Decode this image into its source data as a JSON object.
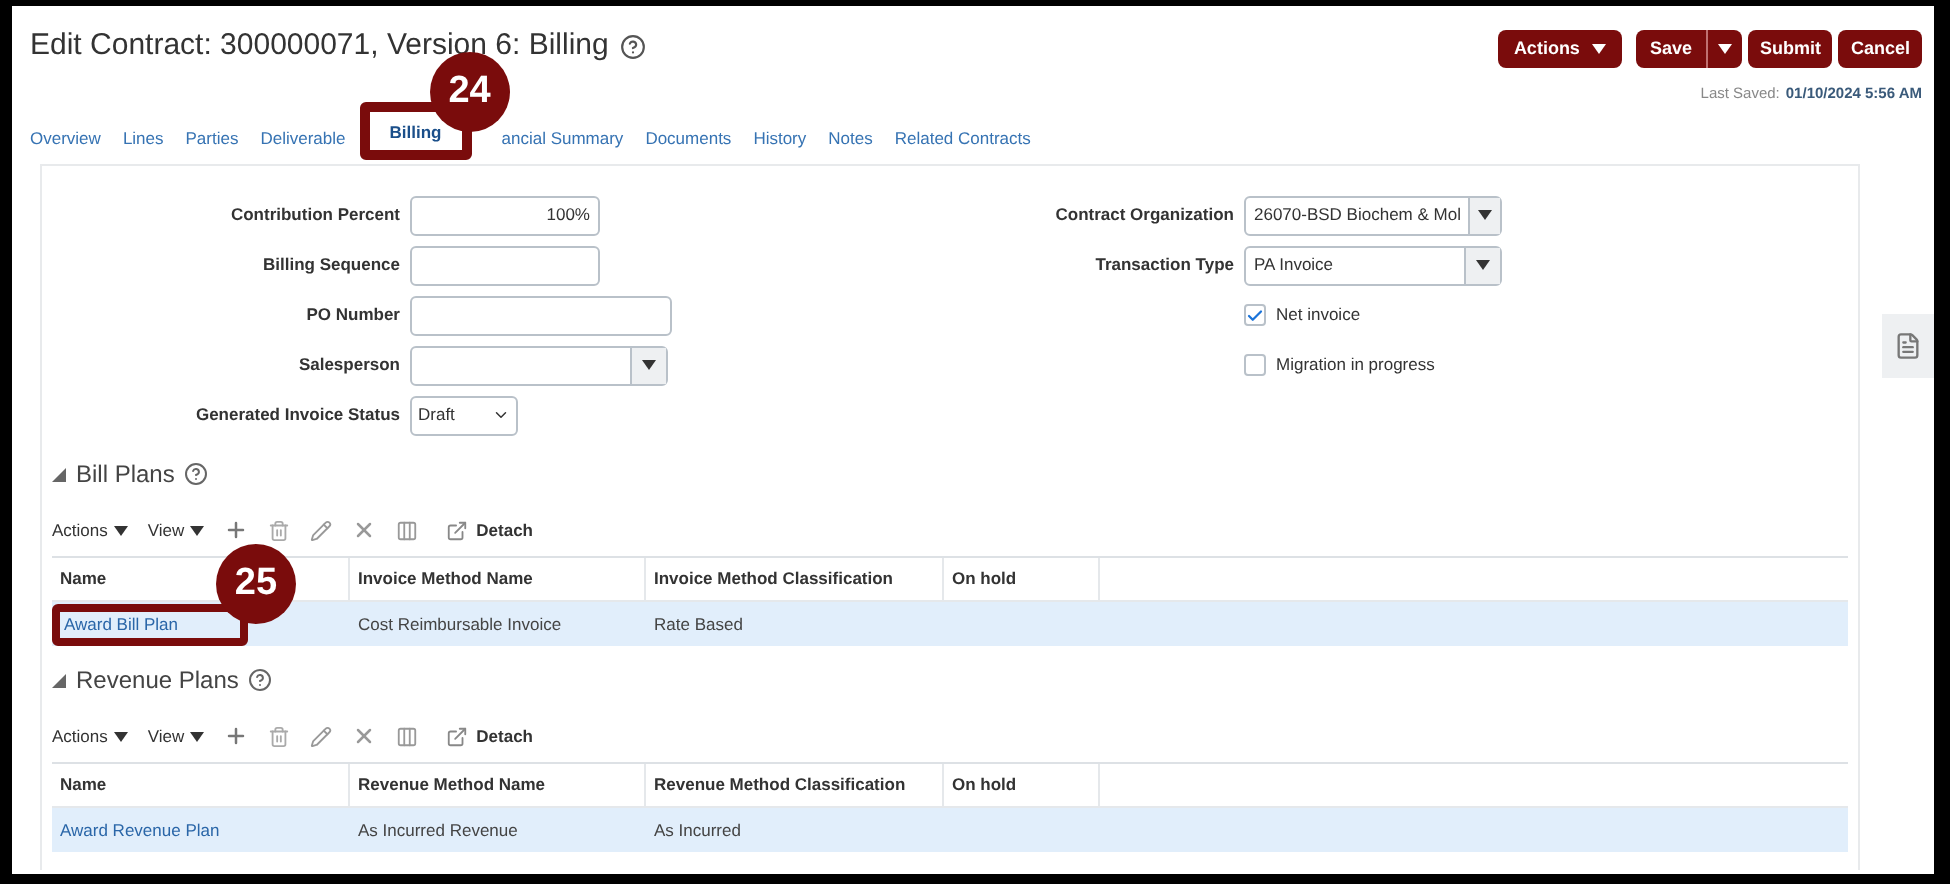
{
  "page_title": "Edit Contract: 300000071, Version 6: Billing",
  "header_buttons": [
    {
      "label": "Actions",
      "kind": "menu"
    },
    {
      "label": "Save",
      "kind": "split"
    },
    {
      "label": "Submit",
      "kind": "plain"
    },
    {
      "label": "Cancel",
      "kind": "plain"
    }
  ],
  "last_saved": {
    "label": "Last Saved:",
    "value": "01/10/2024 5:56 AM"
  },
  "tabs": [
    {
      "label": "Overview",
      "selected": false
    },
    {
      "label": "Lines",
      "selected": false
    },
    {
      "label": "Parties",
      "selected": false
    },
    {
      "label": "Deliverable",
      "selected": false
    },
    {
      "label": "Billing",
      "selected": true,
      "callout": "24"
    },
    {
      "label": "ancial Summary",
      "selected": false
    },
    {
      "label": "Documents",
      "selected": false
    },
    {
      "label": "History",
      "selected": false
    },
    {
      "label": "Notes",
      "selected": false
    },
    {
      "label": "Related Contracts",
      "selected": false
    }
  ],
  "form_left": [
    {
      "label": "Contribution Percent",
      "kind": "number",
      "value": "100%"
    },
    {
      "label": "Billing Sequence",
      "kind": "short-text"
    },
    {
      "label": "PO Number",
      "kind": "text"
    },
    {
      "label": "Salesperson",
      "kind": "lov"
    },
    {
      "label": "Generated Invoice Status",
      "kind": "choice",
      "value": "Draft"
    }
  ],
  "form_right": [
    {
      "label": "Contract Organization",
      "kind": "lov",
      "value": "26070-BSD Biochem & Mol"
    },
    {
      "label": "Transaction Type",
      "kind": "lov",
      "value": "PA Invoice"
    },
    {
      "label": "Net invoice",
      "kind": "checkbox",
      "checked": true
    },
    {
      "label": "Migration in progress",
      "kind": "checkbox",
      "checked": false
    }
  ],
  "sections": [
    {
      "title": "Bill Plans",
      "toolbar": {
        "actions": "Actions",
        "view": "View",
        "detach": "Detach"
      },
      "columns": [
        "Name",
        "Invoice Method Name",
        "Invoice Method Classification",
        "On hold"
      ],
      "rows": [
        {
          "cells": [
            "Award Bill Plan",
            "Cost Reimbursable Invoice",
            "Rate Based"
          ],
          "selected": true,
          "callout": "25"
        }
      ]
    },
    {
      "title": "Revenue Plans",
      "toolbar": {
        "actions": "Actions",
        "view": "View",
        "detach": "Detach"
      },
      "columns": [
        "Name",
        "Revenue Method Name",
        "Revenue Method Classification",
        "On hold"
      ],
      "rows": [
        {
          "cells": [
            "Award Revenue Plan",
            "As Incurred Revenue",
            "As Incurred"
          ],
          "selected": true
        }
      ]
    }
  ]
}
